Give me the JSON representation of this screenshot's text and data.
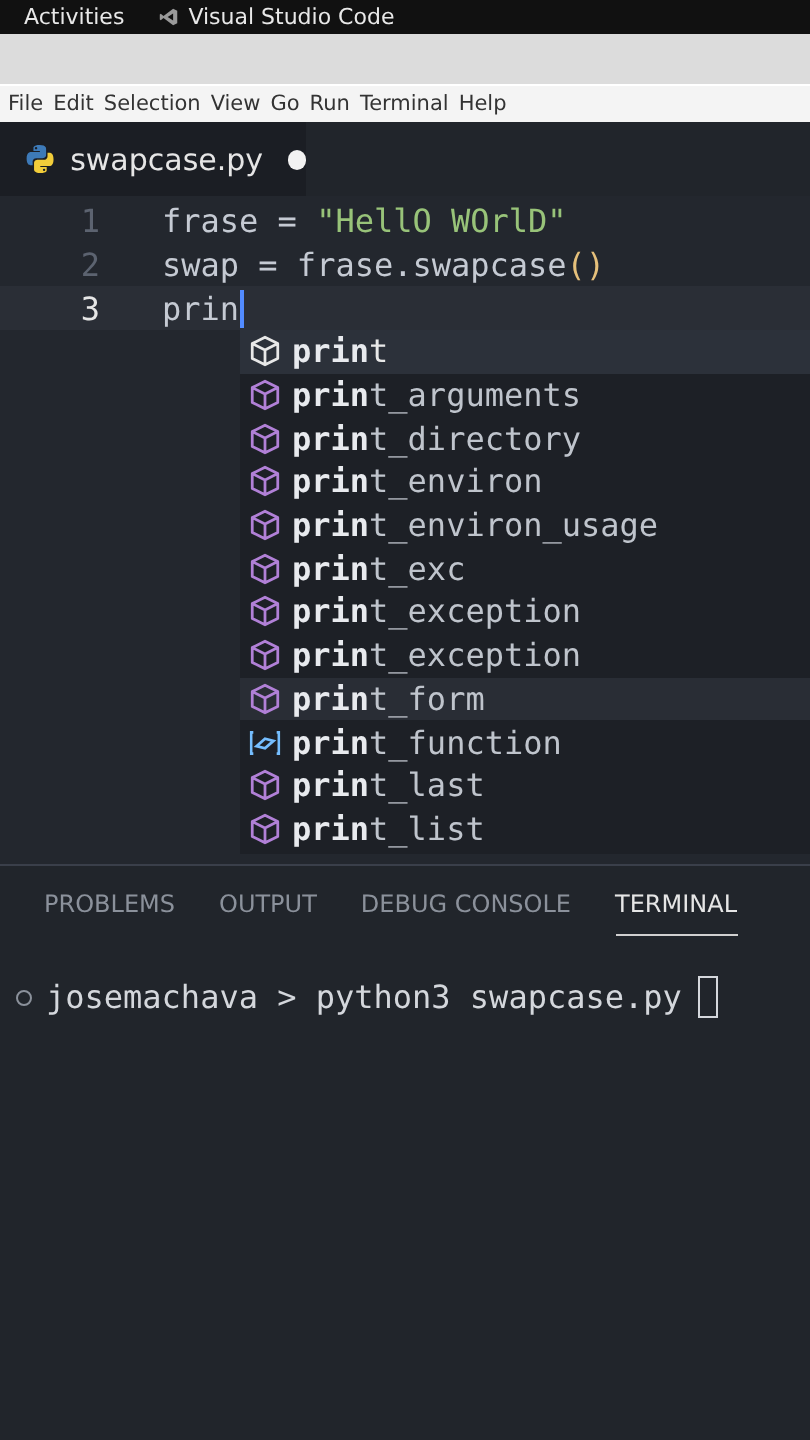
{
  "top_bar": {
    "activities": "Activities",
    "app_name": "Visual Studio Code"
  },
  "menu": [
    "File",
    "Edit",
    "Selection",
    "View",
    "Go",
    "Run",
    "Terminal",
    "Help"
  ],
  "editor_tab": {
    "filename": "swapcase.py",
    "modified": true
  },
  "code_lines": [
    {
      "number": "1",
      "current": false,
      "tokens": [
        {
          "kind": "plain",
          "text": "frase = "
        },
        {
          "kind": "string",
          "text": "\"HellO WOrlD\""
        }
      ]
    },
    {
      "number": "2",
      "current": false,
      "tokens": [
        {
          "kind": "plain",
          "text": "swap = frase.swapcase"
        },
        {
          "kind": "paren",
          "text": "()"
        }
      ]
    },
    {
      "number": "3",
      "current": true,
      "tokens": [
        {
          "kind": "plain",
          "text": "prin"
        }
      ]
    }
  ],
  "suggestions": [
    {
      "kind": "module",
      "label": "**prin**t",
      "selected": true,
      "hovered": false
    },
    {
      "kind": "module",
      "label": "**prin**t_arguments",
      "selected": false,
      "hovered": false
    },
    {
      "kind": "module",
      "label": "**prin**t_directory",
      "selected": false,
      "hovered": false
    },
    {
      "kind": "module",
      "label": "**prin**t_environ",
      "selected": false,
      "hovered": false
    },
    {
      "kind": "module",
      "label": "**prin**t_environ_usage",
      "selected": false,
      "hovered": false
    },
    {
      "kind": "module",
      "label": "**prin**t_exc",
      "selected": false,
      "hovered": false
    },
    {
      "kind": "module",
      "label": "**prin**t_exception",
      "selected": false,
      "hovered": false
    },
    {
      "kind": "module",
      "label": "**prin**t_exception",
      "selected": false,
      "hovered": false
    },
    {
      "kind": "module",
      "label": "**prin**t_form",
      "selected": false,
      "hovered": true
    },
    {
      "kind": "variable",
      "label": "**prin**t_function",
      "selected": false,
      "hovered": false
    },
    {
      "kind": "module",
      "label": "**prin**t_last",
      "selected": false,
      "hovered": false
    },
    {
      "kind": "module",
      "label": "**prin**t_list",
      "selected": false,
      "hovered": false
    }
  ],
  "panel_tabs": [
    {
      "label": "PROBLEMS",
      "selected": false
    },
    {
      "label": "OUTPUT",
      "selected": false
    },
    {
      "label": "DEBUG CONSOLE",
      "selected": false
    },
    {
      "label": "TERMINAL",
      "selected": true
    }
  ],
  "terminal": {
    "prompt": "josemachava > python3 swapcase.py"
  }
}
